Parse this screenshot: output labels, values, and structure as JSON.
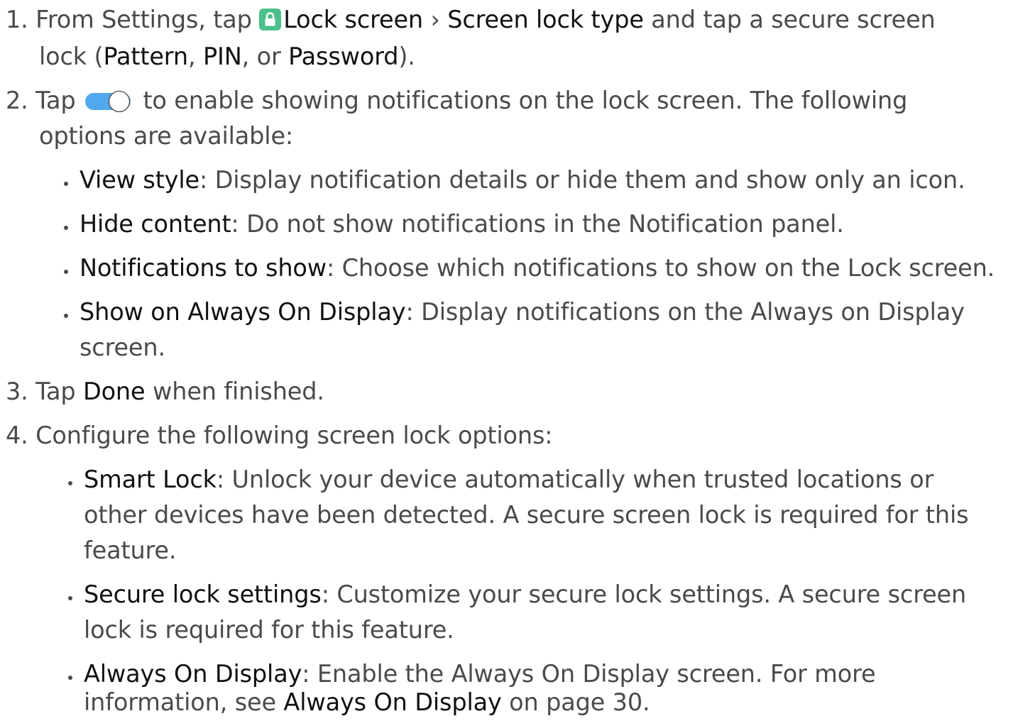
{
  "steps": [
    {
      "number": "1.",
      "pre": "From Settings, tap",
      "icon": "lock-icon",
      "setting": "Lock screen",
      "sep": "›",
      "option": "Screen lock type",
      "post": "and tap a secure screen",
      "line2_pre": "lock (",
      "choices": [
        "Pattern",
        "PIN",
        "Password"
      ],
      "comma1": ", ",
      "comma2": ", or ",
      "line2_post": ")."
    },
    {
      "number": "2.",
      "pre": "Tap",
      "icon": "toggle-icon",
      "post": "to enable showing notifications on the lock screen. The following",
      "line2": "options are available:",
      "bullets": [
        {
          "term": "View style",
          "text": ": Display notification details or hide them and show only an icon."
        },
        {
          "term": "Hide content",
          "text": ": Do not show notifications in the Notification panel."
        },
        {
          "term": "Notifications to show",
          "text": ": Choose which notifications to show on the Lock screen."
        },
        {
          "term": "Show on Always On Display",
          "text": ": Display notifications on the Always on Display",
          "cont": "screen."
        }
      ]
    },
    {
      "number": "3.",
      "pre": "Tap",
      "term": "Done",
      "post": "when finished."
    },
    {
      "number": "4.",
      "text": "Configure the following screen lock options:",
      "bullets": [
        {
          "term": "Smart Lock",
          "text": ": Unlock your device automatically when trusted locations or",
          "cont1": "other devices have been detected. A secure screen lock is required for this",
          "cont2": "feature."
        },
        {
          "term": "Secure lock settings",
          "text": ": Customize your secure lock settings. A secure screen",
          "cont1": "lock is required for this feature."
        },
        {
          "term": "Always On Display",
          "text": ": Enable the Always On Display screen. For more",
          "cont_pre": "information, see ",
          "cont_term": "Always On Display",
          "cont_post": " on page 30."
        }
      ]
    }
  ],
  "colors": {
    "text": "#4a4a4a",
    "emphasis": "#111111",
    "lock_icon_bg": "#4bc08a",
    "toggle_on": "#4fa9ec"
  }
}
